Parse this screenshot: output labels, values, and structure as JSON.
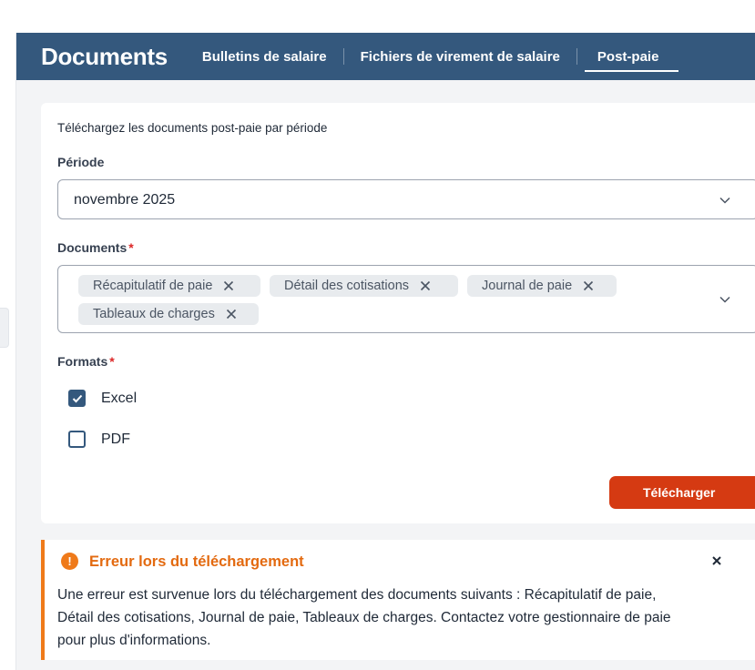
{
  "header": {
    "title": "Documents",
    "tabs": [
      {
        "label": "Bulletins de salaire"
      },
      {
        "label": "Fichiers de virement de salaire"
      },
      {
        "label": "Post-paie"
      }
    ],
    "active_tab": "Post-paie",
    "color": "#34587d"
  },
  "form": {
    "intro": "Téléchargez les documents post-paie par période",
    "period_label": "Période",
    "period_value": "novembre 2025",
    "documents_label": "Documents",
    "required_mark": "*",
    "documents_selected": [
      "Récapitulatif de paie",
      "Détail des cotisations",
      "Journal de paie",
      "Tableaux de charges"
    ],
    "formats_label": "Formats",
    "formats": [
      {
        "label": "Excel",
        "checked": true
      },
      {
        "label": "PDF",
        "checked": false
      }
    ],
    "download_button": "Télécharger",
    "button_color": "#d53a12"
  },
  "alert": {
    "icon": "exclamation-circle-icon",
    "title": "Erreur lors du téléchargement",
    "message": "Une erreur est survenue lors du téléchargement des documents suivants : Récapitulatif de paie, Détail des cotisations, Journal de paie, Tableaux de charges. Contactez votre gestionnaire de paie pour plus d'informations.",
    "color": "#ef7a1a"
  }
}
